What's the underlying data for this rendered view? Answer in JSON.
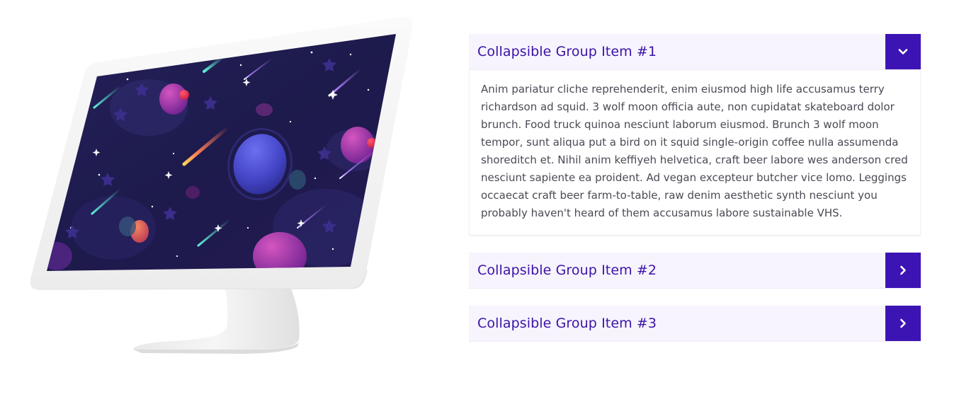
{
  "colors": {
    "accent": "#3d14b4",
    "title_text": "#3b12a8",
    "header_bg": "#f7f4fe",
    "body_text": "#4a4a55"
  },
  "illustration": {
    "name": "monitor-space-illustration",
    "icon": "desktop-monitor-icon"
  },
  "accordion": {
    "items": [
      {
        "title": "Collapsible Group Item #1",
        "expanded": true,
        "toggle_icon": "chevron-down-icon",
        "body": "Anim pariatur cliche reprehenderit, enim eiusmod high life accusamus terry richardson ad squid. 3 wolf moon officia aute, non cupidatat skateboard dolor brunch. Food truck quinoa nesciunt laborum eiusmod. Brunch 3 wolf moon tempor, sunt aliqua put a bird on it squid single-origin coffee nulla assumenda shoreditch et. Nihil anim keffiyeh helvetica, craft beer labore wes anderson cred nesciunt sapiente ea proident. Ad vegan excepteur butcher vice lomo. Leggings occaecat craft beer farm-to-table, raw denim aesthetic synth nesciunt you probably haven't heard of them accusamus labore sustainable VHS."
      },
      {
        "title": "Collapsible Group Item #2",
        "expanded": false,
        "toggle_icon": "chevron-right-icon"
      },
      {
        "title": "Collapsible Group Item #3",
        "expanded": false,
        "toggle_icon": "chevron-right-icon"
      }
    ]
  }
}
